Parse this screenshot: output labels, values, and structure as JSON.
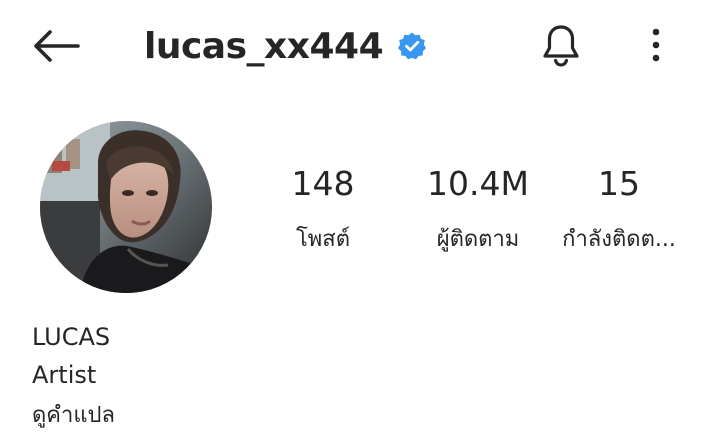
{
  "header": {
    "back_icon": "arrow-left-icon",
    "username": "lucas_xx444",
    "verified_icon": "verified-badge-icon",
    "verified_color": "#3897f0",
    "bell_icon": "bell-icon",
    "more_icon": "more-vertical-icon"
  },
  "profile": {
    "avatar": "profile-photo",
    "stats": [
      {
        "value": "148",
        "label": "โพสต์"
      },
      {
        "value": "10.4M",
        "label": "ผู้ติดตาม"
      },
      {
        "value": "15",
        "label": "กำลังติดต..."
      }
    ],
    "bio": {
      "name": "LUCAS",
      "category": "Artist",
      "translate_label": "ดูคำแปล"
    }
  }
}
